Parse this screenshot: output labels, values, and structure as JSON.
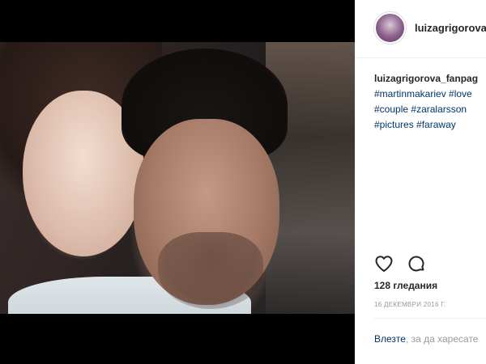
{
  "post": {
    "photo_alt": "selfie-photo"
  },
  "header": {
    "username": "luizagrigorova"
  },
  "caption": {
    "username": "luizagrigorova_fanpag",
    "hashtags": [
      "#martinmakariev",
      "#love",
      "#couple",
      "#zaralarsson",
      "#pictures",
      "#faraway"
    ]
  },
  "actions": {
    "like_icon": "heart-icon",
    "comment_icon": "comment-icon"
  },
  "stats": {
    "views": "128 гледания",
    "date": "16 ДЕКЕМВРИ 2016 Г."
  },
  "login": {
    "link_text": "Влезте",
    "rest_text": ", за да харесате"
  },
  "colors": {
    "link": "#003569",
    "text": "#262626",
    "muted": "#999999",
    "background": "#000000",
    "panel": "#ffffff"
  }
}
